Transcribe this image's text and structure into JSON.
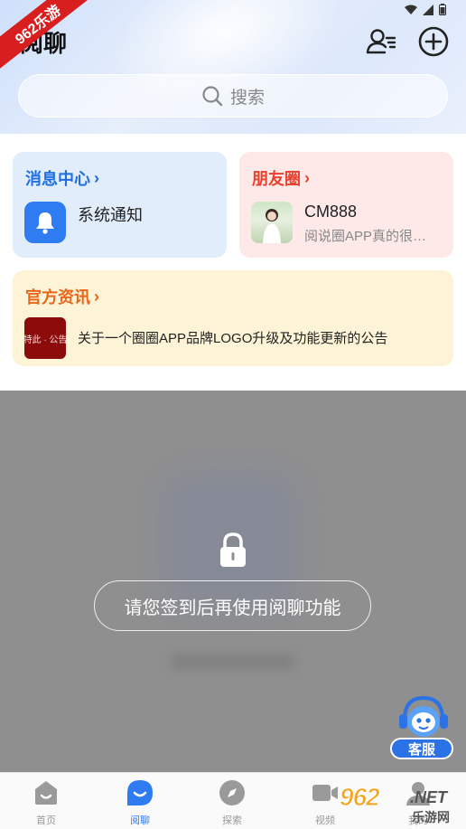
{
  "watermark": {
    "top_left": "962乐游",
    "bottom_right_main": "962",
    "bottom_right_net": ".NET",
    "bottom_right_sub": "乐游网"
  },
  "header": {
    "title": "阅聊",
    "search_placeholder": "搜索",
    "icons": {
      "contacts": "contacts-icon",
      "add": "add-circle-icon"
    }
  },
  "cards": {
    "messages": {
      "title": "消息中心",
      "chevron": "›",
      "item_label": "系统通知",
      "icon": "bell-icon"
    },
    "friends": {
      "title": "朋友圈",
      "chevron": "›",
      "name": "CM888",
      "preview": "阅说圈APP真的很…"
    },
    "news": {
      "title": "官方资讯",
      "chevron": "›",
      "thumb_text": "特此 · 公告",
      "headline": "关于一个圈圈APP品牌LOGO升级及功能更新的公告"
    }
  },
  "locked": {
    "message": "请您签到后再使用阅聊功能",
    "icon": "lock-icon"
  },
  "service": {
    "label": "客服",
    "icon": "robot-headset-icon"
  },
  "bottom_nav": {
    "items": [
      {
        "label": "首页",
        "icon": "home-icon",
        "active": false
      },
      {
        "label": "阅聊",
        "icon": "chat-icon",
        "active": true
      },
      {
        "label": "探索",
        "icon": "compass-icon",
        "active": false
      },
      {
        "label": "视频",
        "icon": "video-icon",
        "active": false
      },
      {
        "label": "我的",
        "icon": "profile-icon",
        "active": false
      }
    ]
  },
  "colors": {
    "accent_blue": "#2e7bf2",
    "messages_title": "#1f6fe0",
    "friends_title": "#e8412f",
    "news_title": "#e8661a",
    "overlay_gray": "#8f8f8f"
  }
}
